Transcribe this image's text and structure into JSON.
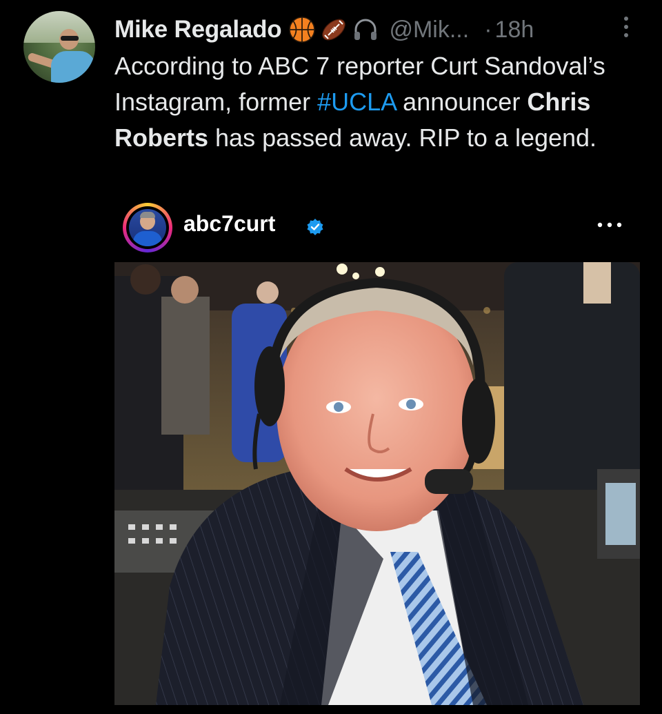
{
  "post": {
    "author": {
      "display_name": "Mike Regalado",
      "handle": "@Mik...",
      "separator": "·",
      "timestamp": "18h",
      "badge_icons": [
        "basketball-icon",
        "football-icon",
        "headphones-icon"
      ]
    },
    "text": {
      "part1": "According to ABC 7 reporter Curt Sandoval’s Instagram, former ",
      "hashtag": "#UCLA",
      "part2": " announcer ",
      "bold_name": "Chris Roberts",
      "part3": " has passed away. RIP to a legend."
    },
    "embed": {
      "username": "abc7curt",
      "verified": true
    }
  },
  "colors": {
    "background": "#000000",
    "text_primary": "#e7e9ea",
    "text_secondary": "#71767b",
    "hashtag": "#1d9bf0",
    "verified": "#1d9bf0"
  }
}
